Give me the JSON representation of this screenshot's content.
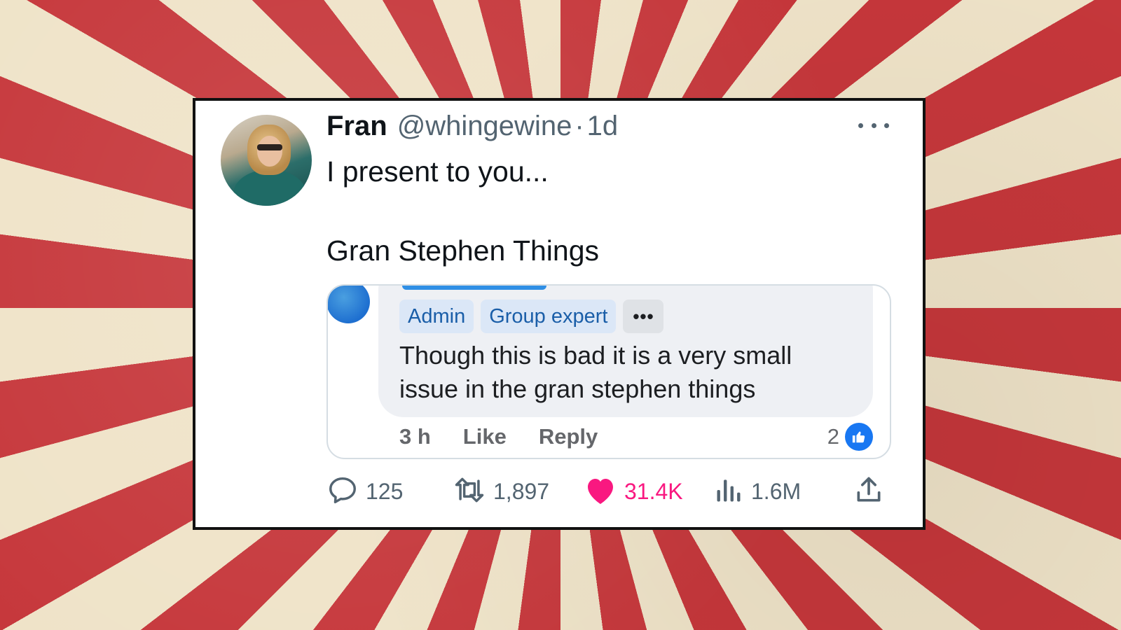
{
  "tweet": {
    "display_name": "Fran",
    "handle": "@whingewine",
    "separator": "·",
    "timestamp": "1d",
    "text_line1": "I present to you...",
    "text_line2": "Gran Stephen Things",
    "embedded_comment": {
      "badges": [
        "Admin",
        "Group expert"
      ],
      "badge_more": "•••",
      "text": "Though this is bad it is a very small issue in the gran stephen things",
      "time": "3 h",
      "like_label": "Like",
      "reply_label": "Reply",
      "reaction_count": "2",
      "reaction_icon": "thumbs-up-icon"
    },
    "actions": {
      "replies": "125",
      "retweets": "1,897",
      "likes": "31.4K",
      "views": "1.6M"
    }
  },
  "colors": {
    "stripe_red": "#c6373b",
    "stripe_cream": "#efe3c8",
    "like_pink": "#f91880",
    "fb_blue": "#1877f2",
    "muted": "#536471"
  }
}
